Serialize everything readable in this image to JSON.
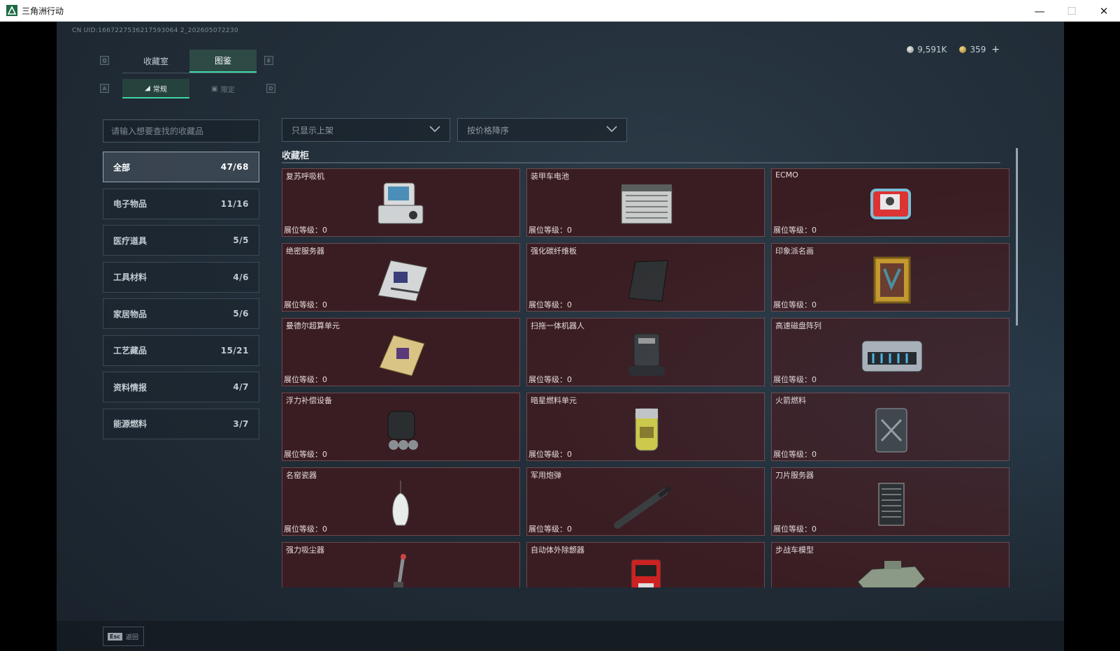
{
  "window": {
    "title": "三角洲行动"
  },
  "header": {
    "uid": "CN UID:1667227536217593064 2_202605072230"
  },
  "currency": {
    "silver": "9,591K",
    "gold": "359",
    "add": "+"
  },
  "tabs": {
    "left_key": "Q",
    "right_key": "E",
    "items": [
      "收藏室",
      "图鉴"
    ],
    "active": 1
  },
  "subtabs": {
    "left_key": "A",
    "right_key": "D",
    "items": [
      "常规",
      "限定"
    ],
    "active": 0
  },
  "search": {
    "placeholder": "请输入想要查找的收藏品"
  },
  "categories": [
    {
      "label": "全部",
      "count": "47/68"
    },
    {
      "label": "电子物品",
      "count": "11/16"
    },
    {
      "label": "医疗道具",
      "count": "5/5"
    },
    {
      "label": "工具材料",
      "count": "4/6"
    },
    {
      "label": "家居物品",
      "count": "5/6"
    },
    {
      "label": "工艺藏品",
      "count": "15/21"
    },
    {
      "label": "资料情报",
      "count": "4/7"
    },
    {
      "label": "能源燃料",
      "count": "3/7"
    }
  ],
  "filters": {
    "listing": "只显示上架",
    "sort": "按价格降序"
  },
  "section": {
    "title": "收藏柜"
  },
  "level_label": "展位等级：",
  "items": [
    {
      "name": "复苏呼吸机",
      "level": "0",
      "icon": "ventilator-icon"
    },
    {
      "name": "装甲车电池",
      "level": "0",
      "icon": "battery-icon"
    },
    {
      "name": "ECMO",
      "level": "0",
      "icon": "ecmo-icon"
    },
    {
      "name": "绝密服务器",
      "level": "0",
      "icon": "server-board-icon"
    },
    {
      "name": "强化碳纤维板",
      "level": "0",
      "icon": "carbon-plate-icon"
    },
    {
      "name": "印象派名画",
      "level": "0",
      "icon": "painting-icon"
    },
    {
      "name": "曼德尔超算单元",
      "level": "0",
      "icon": "compute-unit-icon"
    },
    {
      "name": "扫拖一体机器人",
      "level": "0",
      "icon": "robot-vacuum-icon"
    },
    {
      "name": "高速磁盘阵列",
      "level": "0",
      "icon": "disk-array-icon"
    },
    {
      "name": "浮力补偿设备",
      "level": "0",
      "icon": "buoyancy-device-icon"
    },
    {
      "name": "暗星燃料单元",
      "level": "0",
      "icon": "fuel-cell-icon"
    },
    {
      "name": "火箭燃料",
      "level": "0",
      "icon": "fuel-can-icon"
    },
    {
      "name": "名窑瓷器",
      "level": "0",
      "icon": "porcelain-vase-icon"
    },
    {
      "name": "军用炮弹",
      "level": "0",
      "icon": "artillery-shell-icon"
    },
    {
      "name": "刀片服务器",
      "level": "0",
      "icon": "blade-server-icon"
    },
    {
      "name": "强力吸尘器",
      "level": "",
      "icon": "vacuum-cleaner-icon"
    },
    {
      "name": "自动体外除颤器",
      "level": "",
      "icon": "defibrillator-icon"
    },
    {
      "name": "步战车模型",
      "level": "",
      "icon": "ifv-model-icon"
    }
  ],
  "footer": {
    "esc_key": "Esc",
    "back_label": "返回"
  },
  "colors": {
    "accent": "#3fd6a4",
    "card_bg": "#3a1d22",
    "card_border": "#6b4a4f"
  }
}
